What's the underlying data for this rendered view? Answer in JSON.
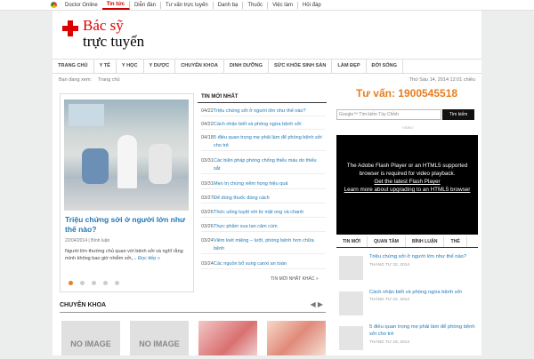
{
  "topbar": {
    "site": "Doctor Online",
    "items": [
      "Tin tức",
      "Diễn đàn",
      "Tư vấn trực tuyến",
      "Danh bạ",
      "Thuốc",
      "Việc làm",
      "Hỏi đáp"
    ]
  },
  "brand": {
    "line1": "Bác sỹ",
    "line2": "trực tuyến"
  },
  "nav": [
    "TRANG CHỦ",
    "Y TẾ",
    "Y HỌC",
    "Y DƯỢC",
    "CHUYÊN KHOA",
    "DINH DƯỠNG",
    "SỨC KHỎE SINH SẢN",
    "LÀM ĐẸP",
    "ĐỜI SỐNG"
  ],
  "breadcrumb": {
    "label": "Bạn đang xem:",
    "home": "Trang chủ",
    "datetime": "Thứ Sáu 14, 2014 12:01 chiều"
  },
  "featured": {
    "title": "Triệu chứng sởi ở người lớn như thế nào?",
    "date": "22/04/2014",
    "author": "Bình luận",
    "desc": "Người lớn thường chủ quan với bệnh sởi và nghĩ rằng mình không bao giờ nhiễm sởi,...",
    "more": "Đọc tiếp »"
  },
  "latest": {
    "heading": "TIN MỚI NHẤT",
    "items": [
      {
        "date": "04/22",
        "title": "Triệu chứng sởi ở người lớn như thế nào?"
      },
      {
        "date": "04/22",
        "title": "Cách nhận biết và phòng ngừa bệnh sởi"
      },
      {
        "date": "04/18",
        "title": "5 điều quan trọng mẹ phải làm để phòng bệnh sởi cho trẻ"
      },
      {
        "date": "03/31",
        "title": "Các biện pháp phòng chống thiếu máu do thiếu sắt"
      },
      {
        "date": "03/31",
        "title": "Mẹo trị chứng viêm họng hiệu quả"
      },
      {
        "date": "03/27",
        "title": "Để dùng thuốc đúng cách"
      },
      {
        "date": "03/26",
        "title": "Thức uống tuyệt vời từ mật ong và chanh"
      },
      {
        "date": "03/26",
        "title": "Thực phẩm xua tan cảm cúm"
      },
      {
        "date": "03/24",
        "title": "Viêm loét miệng – lưỡi, phòng bệnh hơn chữa bệnh"
      },
      {
        "date": "03/24",
        "title": "Các nguồn bổ sung canxi an toàn"
      }
    ],
    "more": "TIN MỚI NHẤT KHÁC »"
  },
  "advice": {
    "text": "Tư vấn: 1900545518"
  },
  "search": {
    "placeholder": "Google™ Tìm kiếm Tùy Chỉnh",
    "button": "Tìm kiếm"
  },
  "video": {
    "caption": "VIDEO",
    "line1": "The Adobe Flash Player or an HTML5 supported browser is required for video playback.",
    "link1": "Get the latest Flash Player",
    "link2": "Learn more about upgrading to an HTML5 browser"
  },
  "rtabs": [
    "TIN MỚI",
    "QUAN TÂM",
    "BÌNH LUẬN",
    "THẺ"
  ],
  "rlist": [
    {
      "title": "Triệu chứng sởi ở người lớn như thế nào?",
      "date": "THÁNG TƯ 22, 2014"
    },
    {
      "title": "Cách nhận biết và phòng ngừa bệnh sởi",
      "date": "THÁNG TƯ 22, 2014"
    },
    {
      "title": "5 điều quan trọng mẹ phải làm để phòng bệnh sởi cho trẻ",
      "date": "THÁNG TƯ 18, 2014"
    }
  ],
  "chuyen": {
    "heading": "CHUYÊN KHOA",
    "arrows": "◀ ▶",
    "noimage": "NO IMAGE"
  }
}
